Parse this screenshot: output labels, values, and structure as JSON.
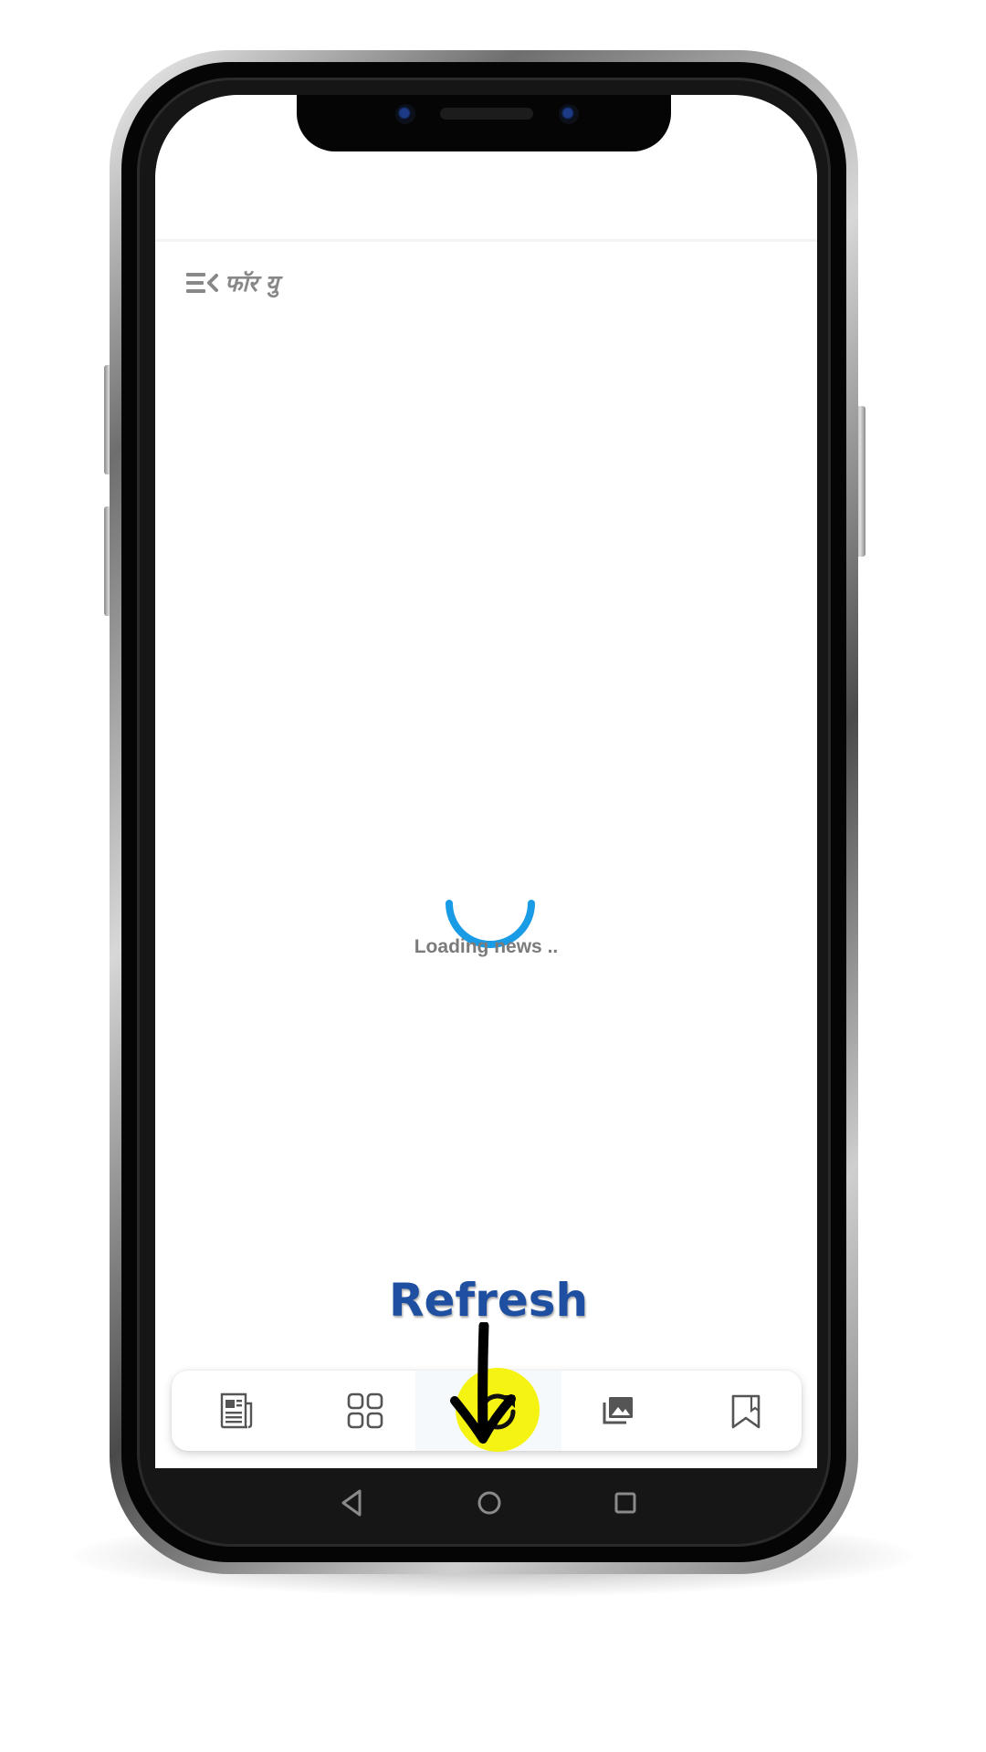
{
  "header": {
    "section_label": "फॉर यु",
    "menu_icon": "menu-collapse-icon"
  },
  "content": {
    "loading_text": "Loading news ..",
    "spinner_color": "#1a9be6"
  },
  "annotation": {
    "label": "Refresh",
    "label_color": "#1f4fa0",
    "arrow_icon": "down-arrow-icon"
  },
  "bottom_nav": {
    "items": [
      {
        "icon": "newspaper-icon"
      },
      {
        "icon": "grid-icon"
      },
      {
        "icon": "refresh-icon",
        "highlight_color": "#f5f312"
      },
      {
        "icon": "photo-gallery-icon"
      },
      {
        "icon": "bookmark-icon"
      }
    ]
  },
  "system_nav": {
    "items": [
      "back-icon",
      "home-icon",
      "recents-icon"
    ]
  }
}
